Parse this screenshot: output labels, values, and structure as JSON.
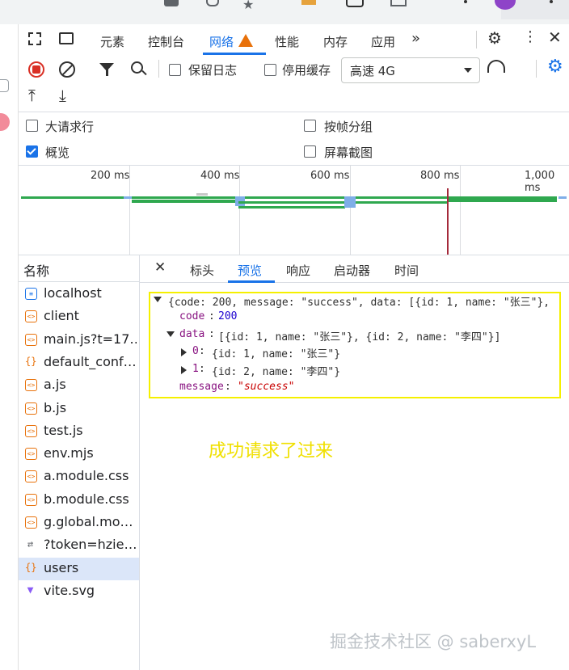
{
  "tabs": [
    "元素",
    "控制台",
    "网络",
    "性能",
    "内存",
    "应用"
  ],
  "toolbar": {
    "preserve_log": "保留日志",
    "disable_cache": "停用缓存",
    "throttle": "高速 4G"
  },
  "options": {
    "big_rows": "大请求行",
    "group_by_frame": "按帧分组",
    "overview": "概览",
    "screenshots": "屏幕截图"
  },
  "timeline": {
    "ticks": [
      "200 ms",
      "400 ms",
      "600 ms",
      "800 ms",
      "1,000 ms"
    ]
  },
  "request_list": {
    "header": "名称",
    "items": [
      {
        "name": "localhost",
        "icon": "document-icon"
      },
      {
        "name": "client",
        "icon": "script-icon"
      },
      {
        "name": "main.js?t=17…",
        "icon": "script-icon"
      },
      {
        "name": "default_conf…",
        "icon": "json-icon"
      },
      {
        "name": "a.js",
        "icon": "script-icon"
      },
      {
        "name": "b.js",
        "icon": "script-icon"
      },
      {
        "name": "test.js",
        "icon": "script-icon"
      },
      {
        "name": "env.mjs",
        "icon": "script-icon"
      },
      {
        "name": "a.module.css",
        "icon": "stylesheet-icon"
      },
      {
        "name": "b.module.css",
        "icon": "stylesheet-icon"
      },
      {
        "name": "g.global.mo…",
        "icon": "stylesheet-icon"
      },
      {
        "name": "?token=hzie…",
        "icon": "websocket-icon"
      },
      {
        "name": "users",
        "icon": "json-icon",
        "selected": true
      },
      {
        "name": "vite.svg",
        "icon": "vite-logo-icon"
      }
    ]
  },
  "detail_tabs": [
    "标头",
    "预览",
    "响应",
    "启动器",
    "时间"
  ],
  "preview": {
    "line1": "{code: 200, message: \"success\", data: [{id: 1, name: \"张三\"},",
    "code_key": "code",
    "code_val": "200",
    "data_key": "data",
    "data_summary": "[{id: 1, name: \"张三\"}, {id: 2, name: \"李四\"}]",
    "item0_key": "0",
    "item0_val": "{id: 1, name: \"张三\"}",
    "item1_key": "1",
    "item1_val": "{id: 2, name: \"李四\"}",
    "message_key": "message",
    "message_val": "\"success\""
  },
  "annotation": "成功请求了过来",
  "watermark": "掘金技术社区 @ saberxyL"
}
